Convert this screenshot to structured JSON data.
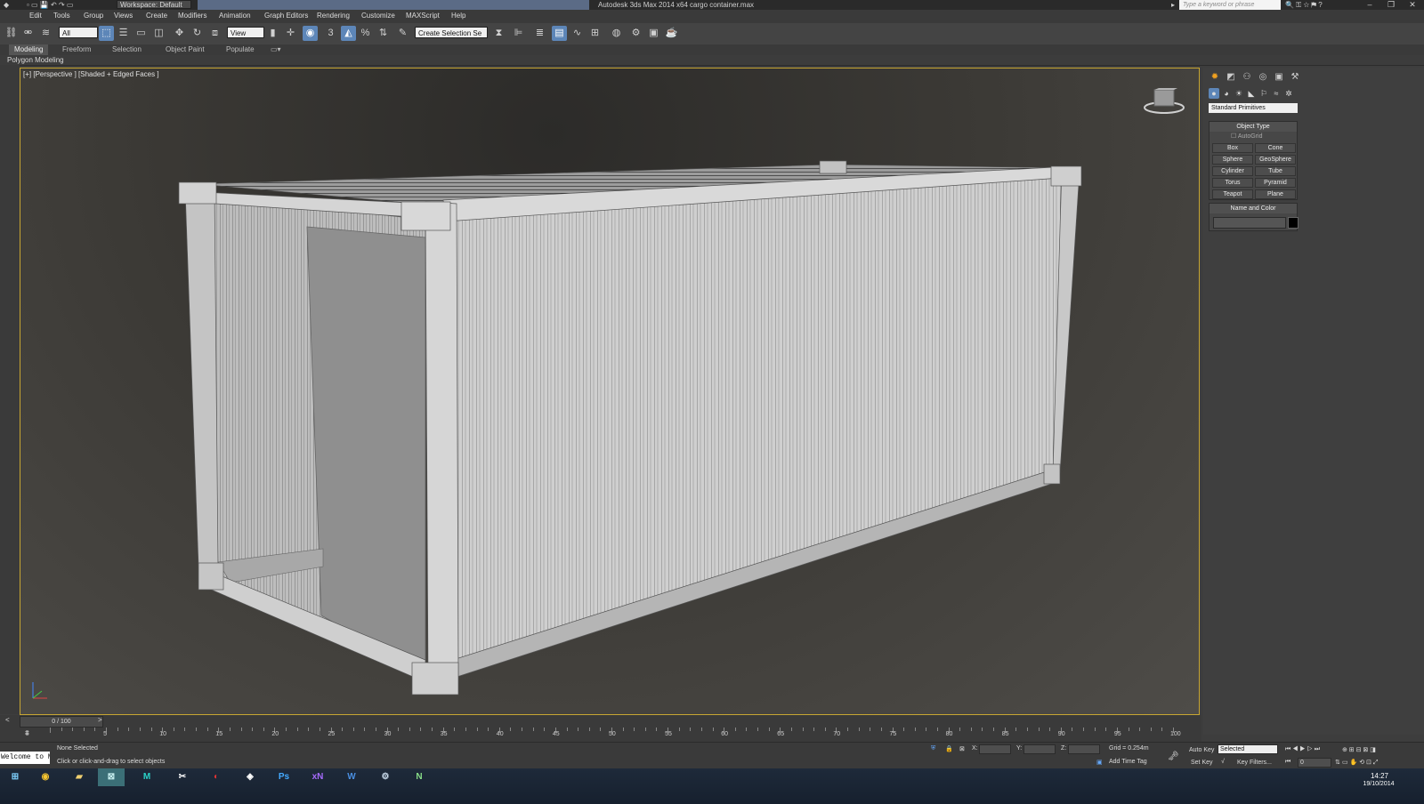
{
  "window": {
    "app_title": "Autodesk 3ds Max 2014 x64",
    "file_title": "cargo container.max",
    "workspace": "Workspace: Default",
    "search_placeholder": "Type a keyword or phrase"
  },
  "menu": [
    "Edit",
    "Tools",
    "Group",
    "Views",
    "Create",
    "Modifiers",
    "Animation",
    "Graph Editors",
    "Rendering",
    "Customize",
    "MAXScript",
    "Help"
  ],
  "toolbar": {
    "filter": "All",
    "ref_coord": "View",
    "named_selection": "Create Selection Se",
    "snap_label": "3"
  },
  "ribbon": {
    "tabs": [
      "Modeling",
      "Freeform",
      "Selection",
      "Object Paint",
      "Populate"
    ],
    "active_tab": "Modeling",
    "panel": "Polygon Modeling"
  },
  "viewport": {
    "label": "[+] [Perspective ] [Shaded + Edged Faces ]",
    "accent": "#c7a632"
  },
  "command_panel": {
    "category": "Standard Primitives",
    "object_type_title": "Object Type",
    "autogrid": "AutoGrid",
    "buttons": [
      "Box",
      "Cone",
      "Sphere",
      "GeoSphere",
      "Cylinder",
      "Tube",
      "Torus",
      "Pyramid",
      "Teapot",
      "Plane"
    ],
    "name_color_title": "Name and Color"
  },
  "timeline": {
    "frame": "0 / 100",
    "ticks": [
      "5",
      "10",
      "15",
      "20",
      "25",
      "30",
      "35",
      "40",
      "45",
      "50",
      "55",
      "60",
      "65",
      "70",
      "75",
      "80",
      "85",
      "90",
      "95",
      "100"
    ]
  },
  "status": {
    "maxscript": "Welcome to M",
    "selection": "None Selected",
    "prompt": "Click or click-and-drag to select objects",
    "x_label": "X:",
    "y_label": "Y:",
    "z_label": "Z:",
    "grid": "Grid = 0.254m",
    "add_time_tag": "Add Time Tag",
    "auto_key": "Auto Key",
    "set_key": "Set Key",
    "key_mode": "Selected",
    "key_filters": "Key Filters...",
    "frame_field": "0"
  },
  "clock": {
    "time": "14:27",
    "date": "19/10/2014"
  },
  "taskbar": [
    "start-orb",
    "chrome",
    "explorer",
    "3dsmax",
    "maya",
    "unity",
    "photoshop",
    "xnormal",
    "word",
    "steam",
    "notepad"
  ]
}
